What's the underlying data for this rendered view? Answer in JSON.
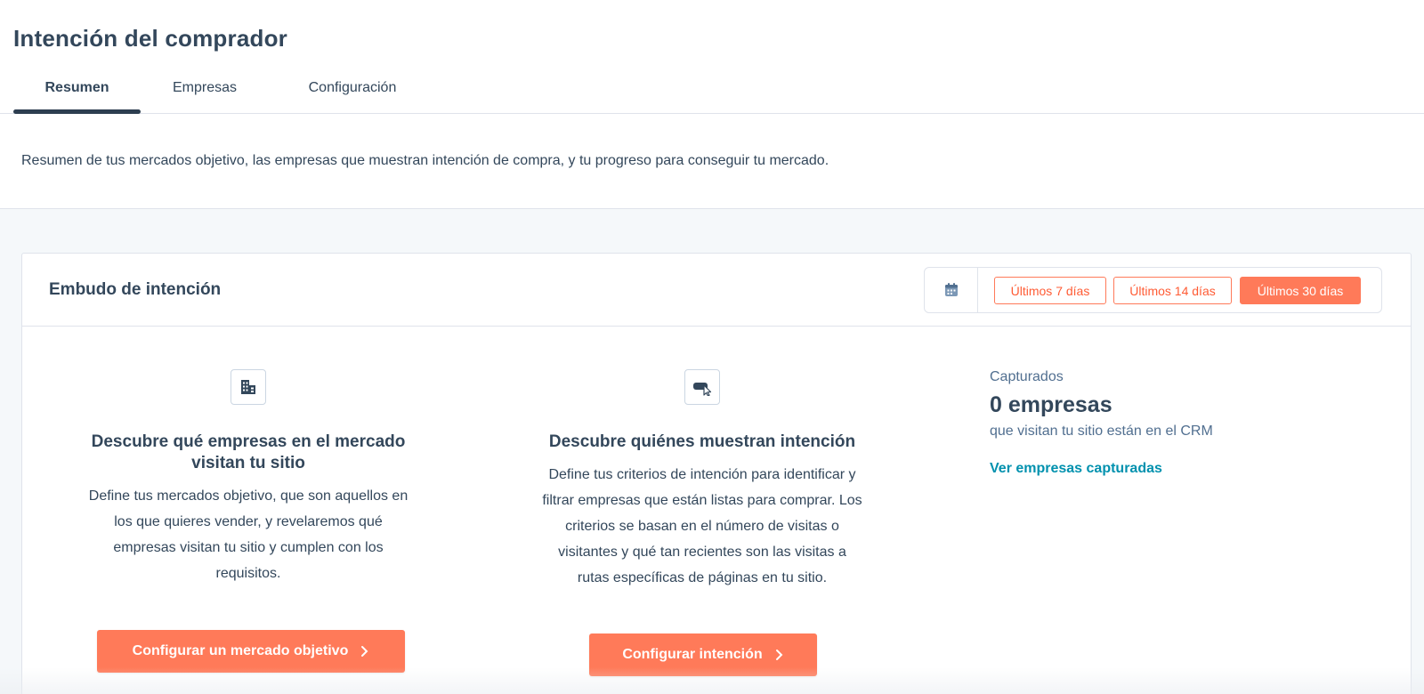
{
  "page": {
    "title": "Intención del comprador",
    "description": "Resumen de tus mercados objetivo, las empresas que muestran intención de compra, y tu progreso para conseguir tu mercado."
  },
  "tabs": [
    {
      "label": "Resumen",
      "active": true
    },
    {
      "label": "Empresas",
      "active": false
    },
    {
      "label": "Configuración",
      "active": false
    }
  ],
  "funnel": {
    "title": "Embudo de intención",
    "calendar_icon": "calendar-icon",
    "ranges": [
      {
        "label": "Últimos 7 días",
        "selected": false
      },
      {
        "label": "Últimos 14 días",
        "selected": false
      },
      {
        "label": "Últimos 30 días",
        "selected": true
      }
    ],
    "col1": {
      "icon": "building-icon",
      "heading_line1": "Descubre qué empresas en el mercado",
      "heading_line2": "visitan tu sitio",
      "body": [
        "Define tus mercados objetivo, que son aquellos en",
        "los que quieres vender, y revelaremos qué",
        "empresas visitan tu sitio y cumplen con los",
        "requisitos."
      ],
      "cta": "Configurar un mercado objetivo"
    },
    "col2": {
      "icon": "cursor-click-icon",
      "heading": "Descubre quiénes muestran intención",
      "body": [
        "Define tus criterios de intención para identificar y",
        "filtrar empresas que están listas para comprar. Los",
        "criterios se basan en el número de visitas o",
        "visitantes y qué tan recientes son las visitas a",
        "rutas específicas de páginas en tu sitio."
      ],
      "cta": "Configurar intención"
    },
    "captured": {
      "label": "Capturados",
      "count": "0 empresas",
      "sub": "que visitan tu sitio están en el CRM",
      "link": "Ver empresas capturadas"
    }
  },
  "colors": {
    "accent": "#ff7a59",
    "text": "#33475b",
    "link": "#0091ae",
    "border": "#dfe3eb",
    "background": "#f5f8fa"
  }
}
